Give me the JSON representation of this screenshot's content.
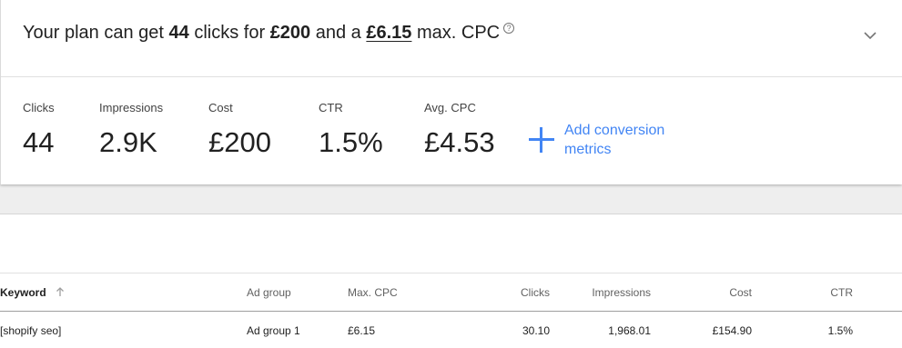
{
  "summary": {
    "prefix": "Your plan can get",
    "clicks": "44",
    "mid1": "clicks for",
    "budget": "£200",
    "mid2": "and a",
    "max_cpc": "£6.15",
    "suffix": "max. CPC",
    "help_glyph": "?"
  },
  "metrics": [
    {
      "label": "Clicks",
      "value": "44"
    },
    {
      "label": "Impressions",
      "value": "2.9K"
    },
    {
      "label": "Cost",
      "value": "£200"
    },
    {
      "label": "CTR",
      "value": "1.5%"
    },
    {
      "label": "Avg. CPC",
      "value": "£4.53"
    }
  ],
  "add_conversion": {
    "line1": "Add conversion",
    "line2": "metrics"
  },
  "table": {
    "headers": {
      "keyword": "Keyword",
      "ad_group": "Ad group",
      "max_cpc": "Max. CPC",
      "clicks": "Clicks",
      "impressions": "Impressions",
      "cost": "Cost",
      "ctr": "CTR"
    },
    "rows": [
      {
        "keyword": "[shopify seo]",
        "ad_group": "Ad group 1",
        "max_cpc": "£6.15",
        "clicks": "30.10",
        "impressions": "1,968.01",
        "cost": "£154.90",
        "ctr": "1.5%"
      }
    ]
  },
  "icons": {
    "help": "help-circle-icon",
    "expand": "chevron-down-icon",
    "add": "plus-icon",
    "sort": "arrow-up-icon"
  },
  "colors": {
    "accent": "#4285f4",
    "text": "#212121",
    "muted": "#616161",
    "page_bg": "#eeeeee"
  }
}
